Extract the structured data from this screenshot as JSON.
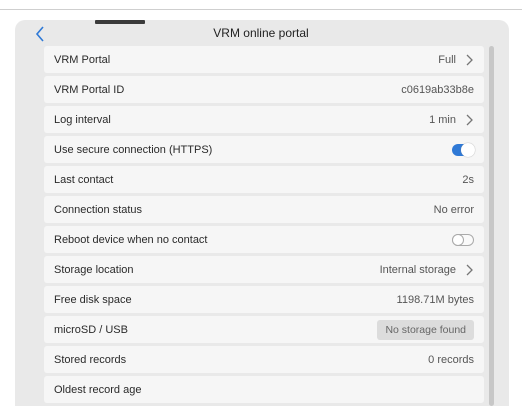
{
  "header": {
    "title": "VRM online portal"
  },
  "rows": [
    {
      "label": "VRM Portal",
      "value": "Full",
      "type": "nav"
    },
    {
      "label": "VRM Portal ID",
      "value": "c0619ab33b8e",
      "type": "text"
    },
    {
      "label": "Log interval",
      "value": "1 min",
      "type": "nav"
    },
    {
      "label": "Use secure connection (HTTPS)",
      "value": "",
      "type": "toggle",
      "state": "on"
    },
    {
      "label": "Last contact",
      "value": "2s",
      "type": "text"
    },
    {
      "label": "Connection status",
      "value": "No error",
      "type": "text"
    },
    {
      "label": "Reboot device when no contact",
      "value": "",
      "type": "toggle",
      "state": "off"
    },
    {
      "label": "Storage location",
      "value": "Internal storage",
      "type": "nav"
    },
    {
      "label": "Free disk space",
      "value": "1198.71M bytes",
      "type": "text"
    },
    {
      "label": "microSD / USB",
      "value": "No storage found",
      "type": "badge"
    },
    {
      "label": "Stored records",
      "value": "0 records",
      "type": "text"
    },
    {
      "label": "Oldest record age",
      "value": "",
      "type": "text"
    }
  ],
  "colors": {
    "accent": "#2f79d6",
    "panel": "#e9e9e9",
    "row": "#f6f6f6"
  }
}
